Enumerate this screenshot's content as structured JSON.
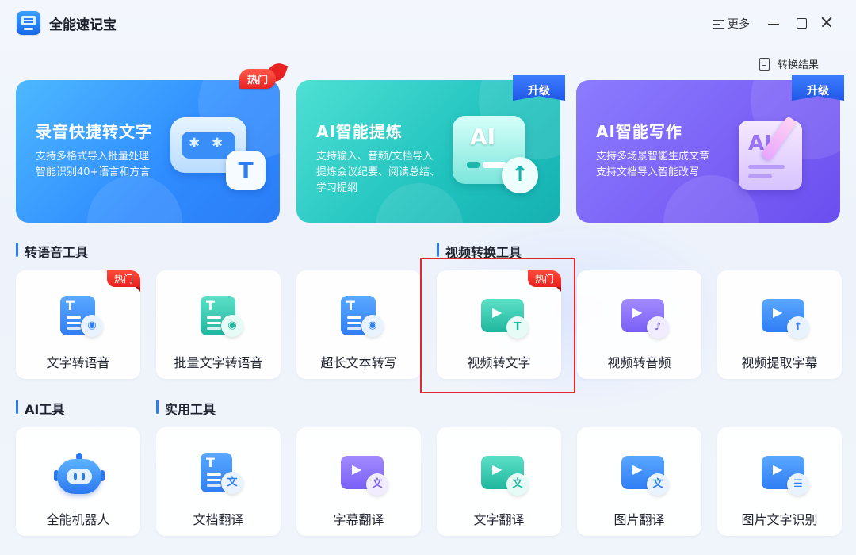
{
  "window": {
    "title": "全能速记宝",
    "more_label": "更多",
    "results_label": "转换结果"
  },
  "banner_cards": [
    {
      "title": "录音快捷转文字",
      "desc": "支持多格式导入批量处理\n智能识别40+语言和方言",
      "badge": "热门"
    },
    {
      "title": "AI智能提炼",
      "desc": "支持输入、音频/文档导入\n提炼会议纪要、阅读总结、\n学习提纲",
      "badge": "升级"
    },
    {
      "title": "AI智能写作",
      "desc": "支持多场景智能生成文章\n支持文档导入智能改写",
      "badge": "升级"
    }
  ],
  "sections": {
    "speech_tools": "转语音工具",
    "video_tools": "视频转换工具",
    "ai_tools": "AI工具",
    "utility_tools": "实用工具"
  },
  "tools_row1": [
    {
      "label": "文字转语音",
      "badge": "热门"
    },
    {
      "label": "批量文字转语音"
    },
    {
      "label": "超长文本转写"
    },
    {
      "label": "视频转文字",
      "badge": "热门"
    },
    {
      "label": "视频转音频"
    },
    {
      "label": "视频提取字幕"
    }
  ],
  "tools_row2": [
    {
      "label": "全能机器人"
    },
    {
      "label": "文档翻译"
    },
    {
      "label": "字幕翻译"
    },
    {
      "label": "文字翻译"
    },
    {
      "label": "图片翻译"
    },
    {
      "label": "图片文字识别"
    }
  ],
  "icon_glyphs": {
    "translate": "文",
    "ai": "AI",
    "upload_arrow": "↑",
    "t": "T",
    "speaker": "◉",
    "music": "♪",
    "ocr": "☰"
  },
  "colors": {
    "accent": "#2b7cf5",
    "hot": "#ea1f1f",
    "upgrade": "#1f57e6",
    "highlight": "#e02a2a"
  }
}
